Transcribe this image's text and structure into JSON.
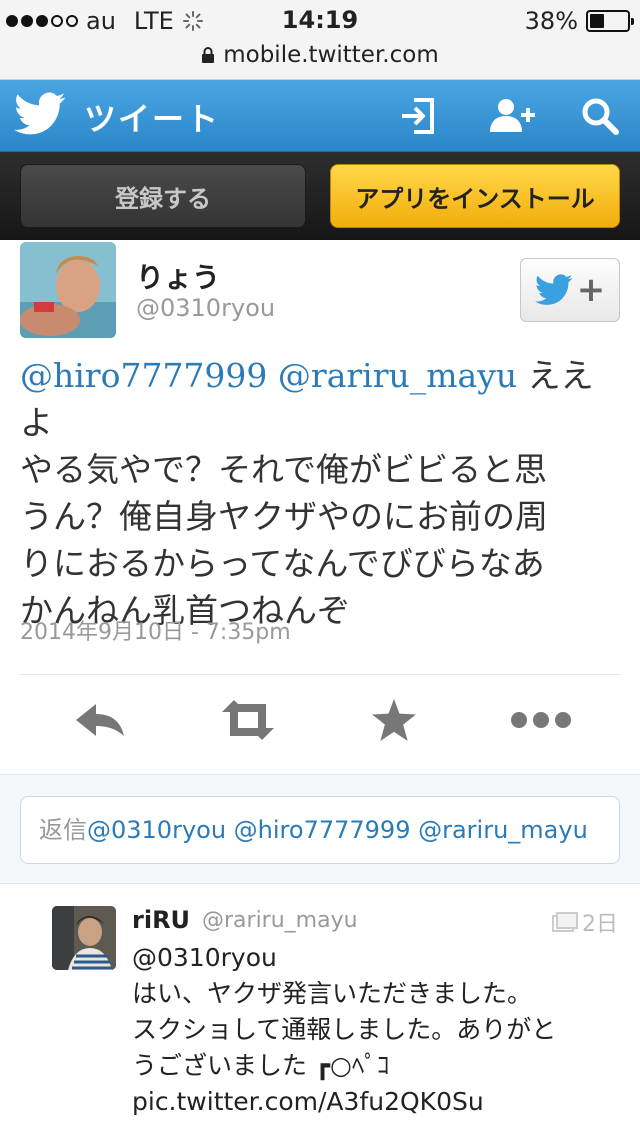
{
  "status_bar": {
    "carrier": "au",
    "network": "LTE",
    "time": "14:19",
    "battery_percent": "38%",
    "battery_level": 0.38
  },
  "url_bar": {
    "url": "mobile.twitter.com"
  },
  "header": {
    "title": "ツイート",
    "icons": [
      "twitter-bird-icon",
      "sign-in-icon",
      "add-user-icon",
      "search-icon"
    ],
    "brand_color": "#2a86c8"
  },
  "action_bar": {
    "register_label": "登録する",
    "install_label": "アプリをインストール"
  },
  "tweet": {
    "author_name": "りょう",
    "author_handle": "@0310ryou",
    "mention_1": "@hiro7777999",
    "mention_2": "@rariru_mayu",
    "line_1_tail": " ええよ",
    "line_2": "やる気やで？それで俺がビビると思",
    "line_3": "うん？俺自身ヤクザやのにお前の周",
    "line_4": "りにおるからってなんでびびらなあ",
    "line_5": "かんねん乳首つねんぞ",
    "date": "2014年9月10日 - 7:35pm",
    "actions": [
      "reply-icon",
      "retweet-icon",
      "favorite-icon",
      "more-icon"
    ]
  },
  "reply_box": {
    "prefix": "返信",
    "handles": "@0310ryou @hiro7777999 @rariru_mayu"
  },
  "reply_tweet": {
    "name": "riRU",
    "handle": "@rariru_mayu",
    "time": "2日",
    "line_1": "@0310ryou",
    "line_2": "はい、ヤクザ発言いただきました。",
    "line_3": "スクショして通報しました。ありがと",
    "line_4": "うございました ┏○ﾍﾟｺ",
    "line_5": "pic.twitter.com/A3fu2QK0Su"
  }
}
